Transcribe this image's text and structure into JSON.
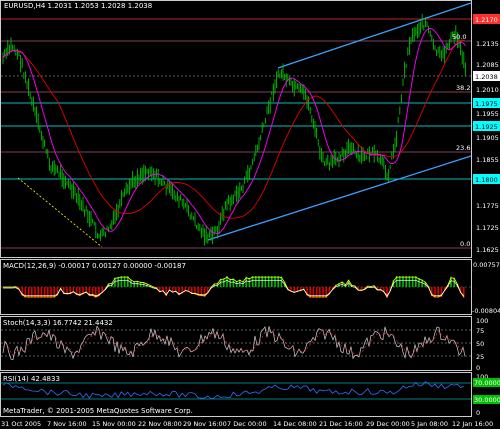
{
  "header": {
    "symbol_info": "EURUSD,H4  1.2031 1.2053 1.2028 1.2038"
  },
  "main_panel": {
    "price_ticks": [
      "1.2135",
      "1.2085",
      "1.2035",
      "1.2010",
      "1.1955",
      "1.1905",
      "1.1855",
      "1.1775",
      "1.1725",
      "1.1675",
      "1.1625"
    ],
    "level_labels": [
      {
        "text": "1.2170",
        "kind": "red"
      },
      {
        "text": "1.2038",
        "kind": "white"
      },
      {
        "text": "1.1975",
        "kind": "cyan"
      },
      {
        "text": "1.1925",
        "kind": "cyan"
      },
      {
        "text": "1.1800",
        "kind": "cyan"
      }
    ],
    "fib_labels": [
      "50.0",
      "38.2",
      "23.6",
      "0.0"
    ],
    "colors": {
      "bars": "#00c000",
      "ma_fast": "#ff00ff",
      "ma_slow": "#e00000",
      "channel": "#3aa0ff",
      "fib": "#ff80c0",
      "level": "#00ffff",
      "resistance": "#ff3030",
      "trend_dotted": "#ffff00"
    }
  },
  "macd_panel": {
    "title": "MACD(12,26,9) -0.00017 0.00127 0.00000 -0.00187",
    "ticks": [
      "0.00757",
      "-0.00804"
    ]
  },
  "stoch_panel": {
    "title": "Stoch(14,3,3) 16.7742 21.4432",
    "ticks": [
      "100",
      "75",
      "50",
      "25",
      "0"
    ]
  },
  "rsi_panel": {
    "title": "RSI(14) 42.4833",
    "ticks": [
      "100",
      "70.0000",
      "30.0000",
      "0"
    ]
  },
  "footer": {
    "copyright": "MetaTrader, © 2001-2005 MetaQuotes Software Corp.",
    "time_labels": [
      "31 Oct 2005",
      "7 Nov 16:00",
      "15 Nov 00:00",
      "22 Nov 08:00",
      "29 Nov 16:00",
      "7 Dec 00:00",
      "14 Dec 08:00",
      "21 Dec 16:00",
      "29 Dec 00:00",
      "5 Jan 08:00",
      "12 Jan 16:00"
    ]
  }
}
